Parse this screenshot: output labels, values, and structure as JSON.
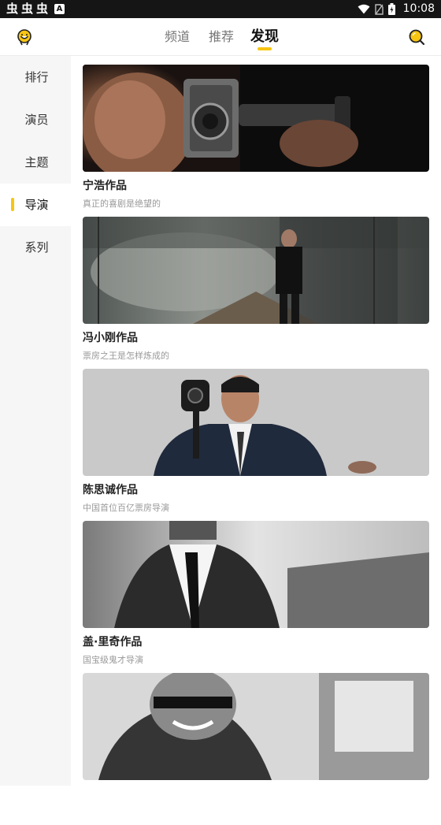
{
  "status_bar": {
    "app_glyphs": [
      "虫",
      "虫",
      "虫"
    ],
    "a_badge": "A",
    "time": "10:08",
    "icons": [
      "wifi-icon",
      "no-sim-icon",
      "battery-icon"
    ]
  },
  "nav": {
    "tabs": [
      {
        "label": "频道",
        "active": false
      },
      {
        "label": "推荐",
        "active": false
      },
      {
        "label": "发现",
        "active": true
      }
    ],
    "left_icon": "logo-icon",
    "right_icon": "search-icon"
  },
  "sidebar": {
    "items": [
      {
        "label": "排行",
        "active": false
      },
      {
        "label": "演员",
        "active": false
      },
      {
        "label": "主题",
        "active": false
      },
      {
        "label": "导演",
        "active": true
      },
      {
        "label": "系列",
        "active": false
      }
    ]
  },
  "cards": [
    {
      "title": "宁浩作品",
      "subtitle": "真正的喜剧是绝望的"
    },
    {
      "title": "冯小刚作品",
      "subtitle": "票房之王是怎样炼成的"
    },
    {
      "title": "陈思诚作品",
      "subtitle": "中国首位百亿票房导演"
    },
    {
      "title": "盖·里奇作品",
      "subtitle": "国宝级鬼才导演"
    },
    {
      "title": "",
      "subtitle": ""
    }
  ],
  "colors": {
    "accent": "#f7c512",
    "status_bar": "#151515",
    "sidebar_bg": "#f6f6f6"
  }
}
